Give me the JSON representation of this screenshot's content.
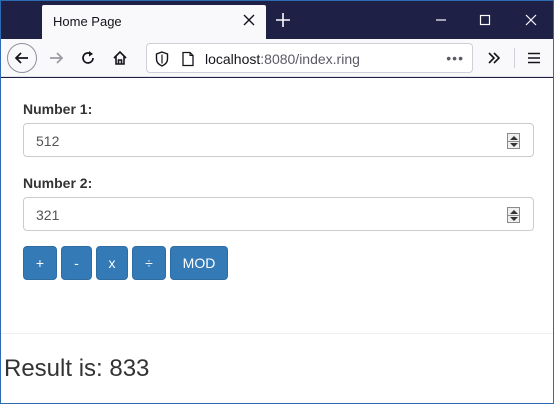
{
  "browser": {
    "tab_title": "Home Page",
    "url_host": "localhost",
    "url_rest": ":8080/index.ring",
    "url_more": "•••"
  },
  "form": {
    "number1_label": "Number 1:",
    "number1_value": "512",
    "number2_label": "Number 2:",
    "number2_value": "321"
  },
  "buttons": {
    "add": "+",
    "subtract": "-",
    "multiply": "x",
    "divide": "÷",
    "mod": "MOD"
  },
  "result": {
    "text": "Result is: 833"
  },
  "colors": {
    "primary_button": "#337ab7",
    "titlebar": "#1f2045"
  }
}
